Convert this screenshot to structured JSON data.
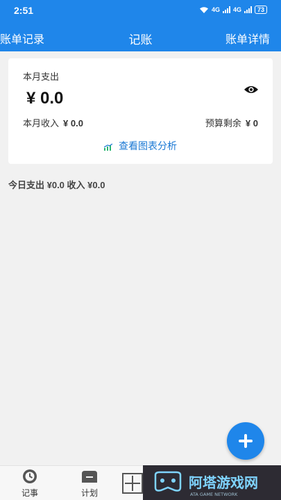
{
  "status_bar": {
    "time": "2:51",
    "network_1": "4G",
    "network_2": "4G",
    "battery": "73"
  },
  "nav": {
    "left": "账单记录",
    "title": "记账",
    "right": "账单详情"
  },
  "summary": {
    "expense_label": "本月支出",
    "expense_amount": "¥ 0.0",
    "income_label": "本月收入",
    "income_amount": "¥ 0.0",
    "budget_label": "预算剩余",
    "budget_amount": "¥ 0",
    "chart_link": "查看图表分析"
  },
  "today": {
    "text": "今日支出 ¥0.0 收入 ¥0.0"
  },
  "tabs": [
    {
      "label": "记事"
    },
    {
      "label": "计划"
    }
  ],
  "watermark": {
    "brand": "阿塔游戏网",
    "sub": "ATA GAME NETWORK"
  },
  "colors": {
    "primary": "#1f86ea",
    "link": "#1a78d4",
    "background": "#f1f1f1"
  }
}
